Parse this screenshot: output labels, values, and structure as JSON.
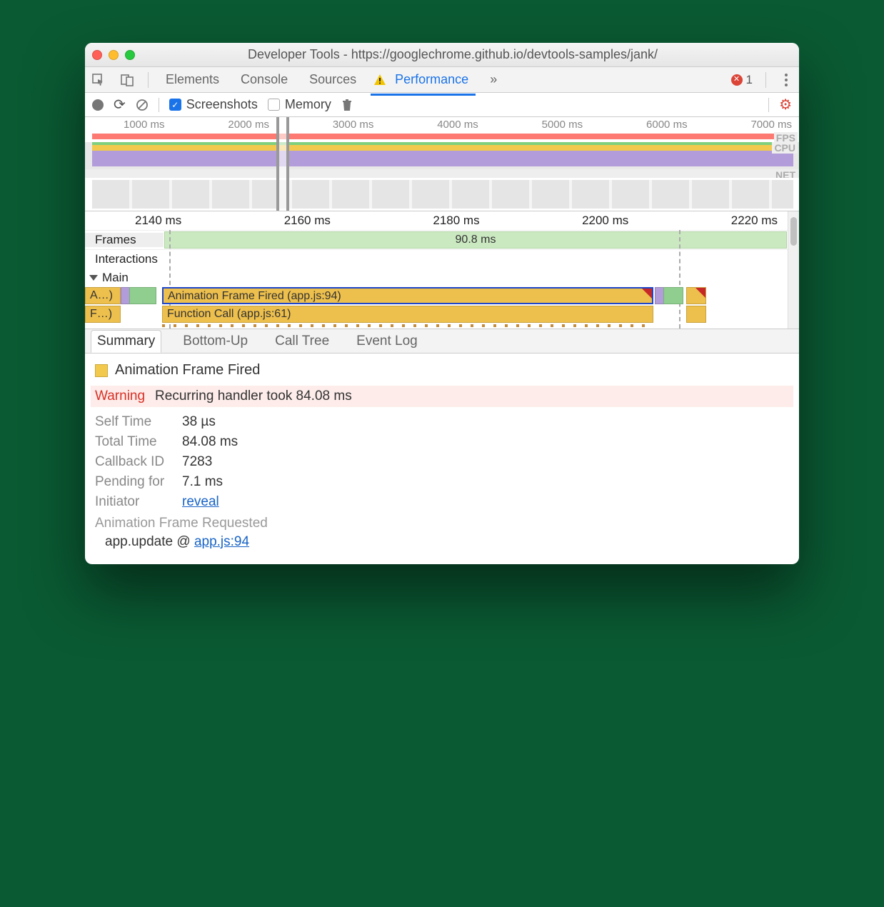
{
  "window": {
    "title": "Developer Tools - https://googlechrome.github.io/devtools-samples/jank/"
  },
  "tabs": {
    "elements": "Elements",
    "console": "Console",
    "sources": "Sources",
    "performance": "Performance",
    "more": "»",
    "error_count": "1"
  },
  "toolbar": {
    "screenshots": "Screenshots",
    "memory": "Memory"
  },
  "overview": {
    "ticks": [
      "1000 ms",
      "2000 ms",
      "3000 ms",
      "4000 ms",
      "5000 ms",
      "6000 ms",
      "7000 ms"
    ],
    "fps_label": "FPS",
    "cpu_label": "CPU",
    "net_label": "NET"
  },
  "flame": {
    "ruler": [
      "2140 ms",
      "2160 ms",
      "2180 ms",
      "2200 ms",
      "2220 ms"
    ],
    "frames_label": "Frames",
    "frames_value": "90.8 ms",
    "interactions": "Interactions",
    "main": "Main",
    "bar_a": "A…)",
    "bar_f": "F…)",
    "bar_anim": "Animation Frame Fired (app.js:94)",
    "bar_func": "Function Call (app.js:61)"
  },
  "btabs": {
    "summary": "Summary",
    "bottomup": "Bottom-Up",
    "calltree": "Call Tree",
    "eventlog": "Event Log"
  },
  "summary": {
    "title": "Animation Frame Fired",
    "warn_label": "Warning",
    "warn_text": "Recurring handler took 84.08 ms",
    "self_time_k": "Self Time",
    "self_time_v": "38 µs",
    "total_time_k": "Total Time",
    "total_time_v": "84.08 ms",
    "cb_k": "Callback ID",
    "cb_v": "7283",
    "pending_k": "Pending for",
    "pending_v": "7.1 ms",
    "initiator_k": "Initiator",
    "initiator_v": "reveal",
    "subhead": "Animation Frame Requested",
    "stack_fn": "app.update @ ",
    "stack_link": "app.js:94"
  }
}
